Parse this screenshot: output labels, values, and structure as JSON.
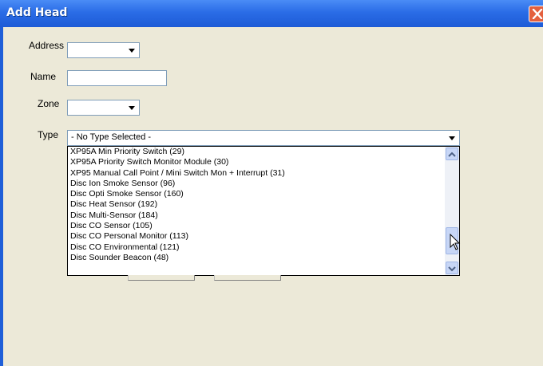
{
  "window": {
    "title": "Add Head"
  },
  "form": {
    "address_label": "Address",
    "name_label": "Name",
    "zone_label": "Zone",
    "type_label": "Type",
    "address_value": "",
    "name_value": "",
    "zone_value": "",
    "type_value": "- No Type Selected -"
  },
  "type_dropdown": {
    "options": [
      "XP95A Min Priority Switch (29)",
      "XP95A Priority Switch Monitor Module (30)",
      "XP95  Manual Call Point / Mini Switch Mon + Interrupt (31)",
      "Disc Ion Smoke Sensor (96)",
      "Disc Opti Smoke Sensor (160)",
      "Disc Heat Sensor (192)",
      "Disc Multi-Sensor (184)",
      "Disc CO Sensor (105)",
      "Disc  CO Personal Monitor (113)",
      "Disc  CO Environmental (121)",
      "Disc Sounder Beacon (48)"
    ]
  },
  "icons": {
    "close": "close-icon",
    "dropdown_arrow": "chevron-down-icon",
    "scroll_up": "scroll-up-icon",
    "scroll_down": "scroll-down-icon",
    "cursor": "mouse-pointer-icon"
  },
  "colors": {
    "titlebar": "#2a6ce6",
    "dialog_bg": "#ece9d8",
    "close_button": "#e4603e",
    "scrollbar": "#c7d6f6"
  }
}
